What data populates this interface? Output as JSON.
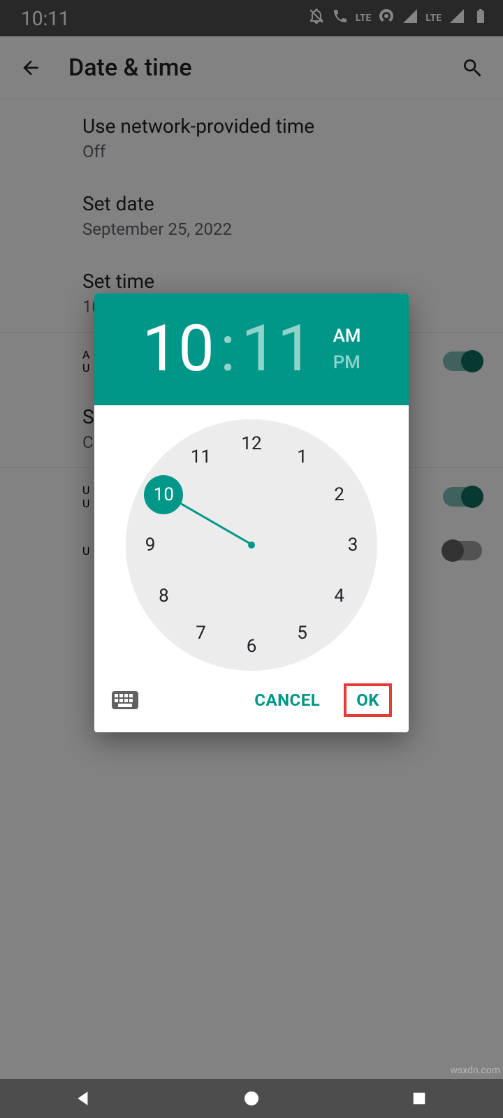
{
  "statusbar": {
    "time": "10:11",
    "lte_label": "LTE"
  },
  "appbar": {
    "title": "Date & time"
  },
  "settings": {
    "network_time": {
      "label": "Use network-provided time",
      "value": "Off"
    },
    "set_date": {
      "label": "Set date",
      "value": "September 25, 2022"
    },
    "set_time": {
      "label": "Set time",
      "value": "10:11 AM"
    },
    "row_a": {
      "primary": "A",
      "secondary": "U",
      "toggle": true
    },
    "row_b": {
      "primary": "S",
      "secondary": "C"
    },
    "row_c": {
      "primary": "U",
      "secondary": "U",
      "toggle": true
    },
    "row_d": {
      "primary": "U",
      "secondary": "",
      "toggle": false
    }
  },
  "picker": {
    "hour": "10",
    "minute": "11",
    "am": "AM",
    "pm": "PM",
    "selected_period": "AM",
    "selected_hour": 10,
    "hours": [
      "12",
      "1",
      "2",
      "3",
      "4",
      "5",
      "6",
      "7",
      "8",
      "9",
      "10",
      "11"
    ],
    "cancel": "CANCEL",
    "ok": "OK"
  },
  "watermark": "wsxdn.com"
}
